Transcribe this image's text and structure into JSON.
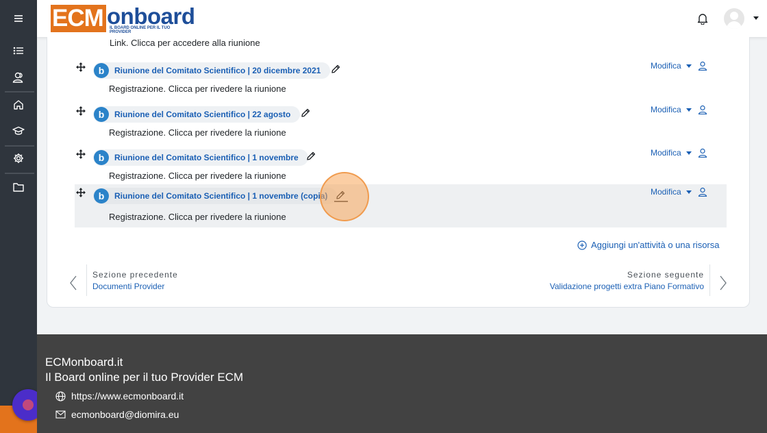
{
  "header": {
    "logo_ecm": "ECM",
    "logo_word": "onboard",
    "logo_tagline": "IL BOARD ONLINE PER IL TUO PROVIDER"
  },
  "sidebar": {
    "items": [
      "menu-icon",
      "list-icon",
      "users-icon",
      "home-icon",
      "graduation-cap-icon",
      "gear-icon",
      "folder-icon"
    ]
  },
  "course": {
    "top_link_text": "Link. Clicca per accedere alla riunione",
    "activities": [
      {
        "name": "Riunione del Comitato Scientifico | 20 dicembre 2021",
        "description": "Registrazione. Clicca per rivedere la riunione",
        "edit_label": "Modifica"
      },
      {
        "name": "Riunione del Comitato Scientifico | 22 agosto",
        "description": "Registrazione. Clicca per rivedere la riunione",
        "edit_label": "Modifica"
      },
      {
        "name": "Riunione del Comitato Scientifico | 1 novembre",
        "description": "Registrazione. Clicca per rivedere la riunione",
        "edit_label": "Modifica"
      },
      {
        "name": "Riunione del Comitato Scientifico | 1 novembre (copia)",
        "description": "Registrazione. Clicca per rivedere la riunione",
        "edit_label": "Modifica"
      }
    ],
    "add_activity": "Aggiungi un'attività o una risorsa",
    "prev_section_label": "Sezione precedente",
    "prev_section_name": "Documenti Provider",
    "next_section_label": "Sezione seguente",
    "next_section_name": "Validazione progetti extra Piano Formativo"
  },
  "footer": {
    "site_name": "ECMonboard.it",
    "tagline": "Il Board online per il tuo Provider ECM",
    "website": "https://www.ecmonboard.it",
    "email": "ecmonboard@diomira.eu"
  },
  "colors": {
    "brand_orange": "#e3731c",
    "brand_blue": "#1e4e99",
    "link_blue": "#1a5fb4",
    "sidebar_bg": "#2f353d",
    "footer_bg": "#424242"
  }
}
